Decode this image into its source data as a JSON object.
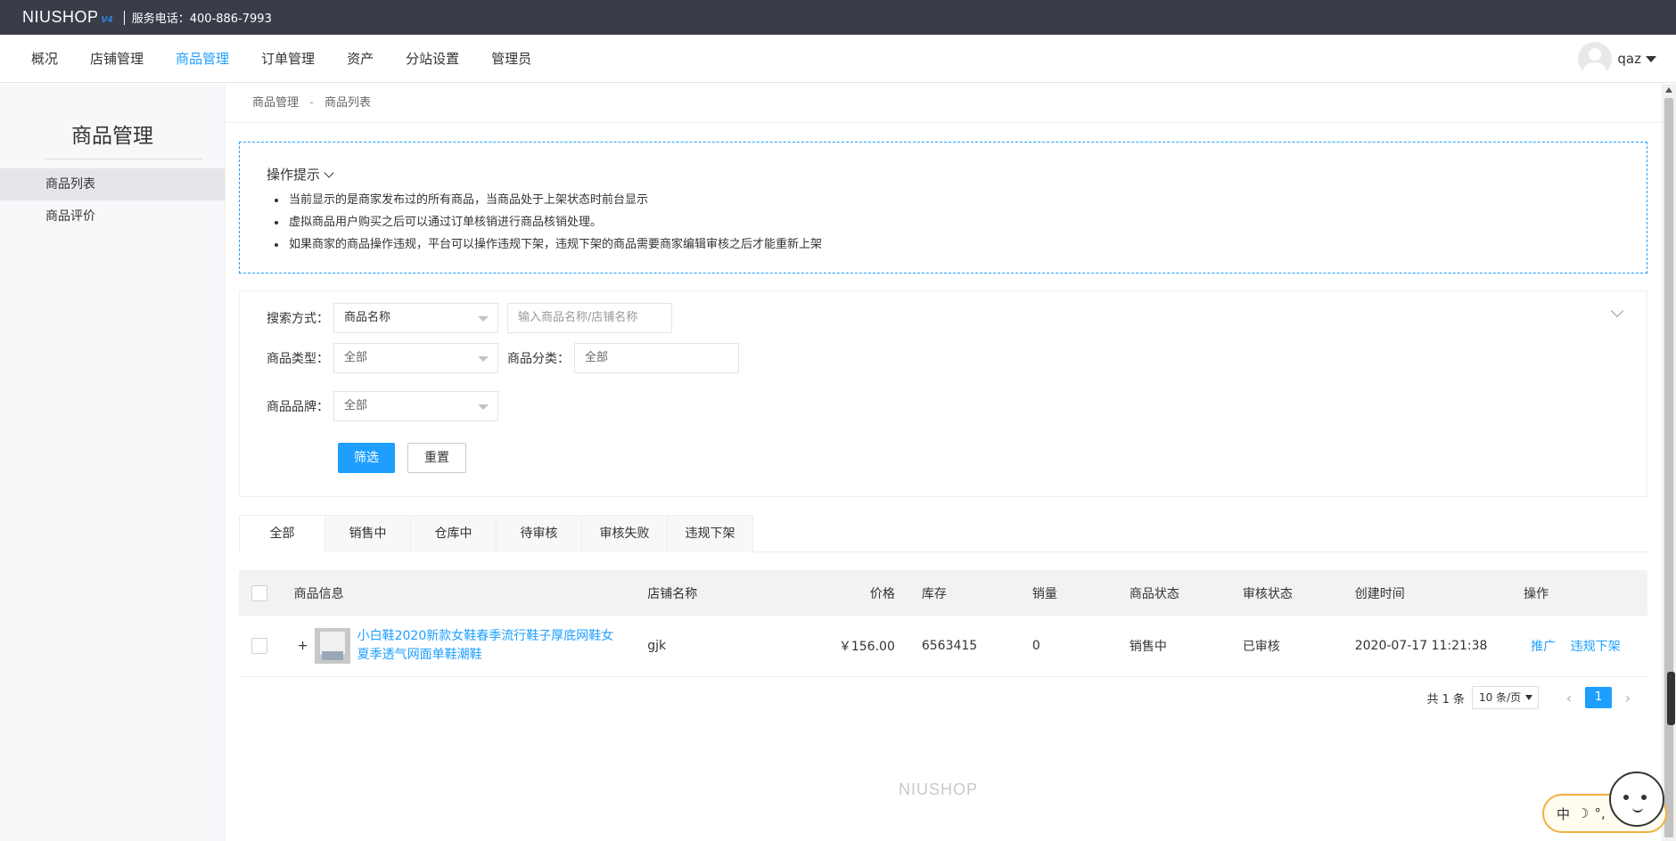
{
  "topbar": {
    "logo": "NIUSHOP",
    "logo_version": "V4",
    "phone": "服务电话：400-886-7993"
  },
  "nav": {
    "items": [
      "概况",
      "店铺管理",
      "商品管理",
      "订单管理",
      "资产",
      "分站设置",
      "管理员"
    ],
    "active_index": 2,
    "user_name": "qaz"
  },
  "sidebar": {
    "title": "商品管理",
    "items": [
      "商品列表",
      "商品评价"
    ],
    "active_index": 0
  },
  "breadcrumb": {
    "parent": "商品管理",
    "separator": "-",
    "current": "商品列表"
  },
  "tips": {
    "title": "操作提示",
    "items": [
      "当前显示的是商家发布过的所有商品，当商品处于上架状态时前台显示",
      "虚拟商品用户购买之后可以通过订单核销进行商品核销处理。",
      "如果商家的商品操作违规，平台可以操作违规下架，违规下架的商品需要商家编辑审核之后才能重新上架"
    ]
  },
  "filter": {
    "search_label": "搜索方式：",
    "search_select": "商品名称",
    "search_placeholder": "输入商品名称/店铺名称",
    "type_label": "商品类型：",
    "type_value": "全部",
    "category_label": "商品分类：",
    "category_value": "全部",
    "brand_label": "商品品牌：",
    "brand_value": "全部",
    "submit_label": "筛选",
    "reset_label": "重置"
  },
  "tabs": [
    "全部",
    "销售中",
    "仓库中",
    "待审核",
    "审核失败",
    "违规下架"
  ],
  "table": {
    "headers": [
      "商品信息",
      "店铺名称",
      "价格",
      "库存",
      "销量",
      "商品状态",
      "审核状态",
      "创建时间",
      "操作"
    ],
    "rows": [
      {
        "expand": "+",
        "name": "小白鞋2020新款女鞋春季流行鞋子厚底网鞋女夏季透气网面单鞋潮鞋",
        "shop": "gjk",
        "price": "￥156.00",
        "stock": "6563415",
        "sales": "0",
        "status": "销售中",
        "audit": "已审核",
        "created": "2020-07-17 11:21:38",
        "actions": [
          "推广",
          "违规下架"
        ]
      }
    ]
  },
  "pager": {
    "total": "共 1 条",
    "page_size": "10 条/页",
    "prev": "‹",
    "next": "›",
    "current": "1"
  },
  "footer": {
    "logo": "NIUSHOP"
  },
  "ime": {
    "lang": "中",
    "moon": "☽",
    "punct": "°,"
  },
  "colors": {
    "accent": "#1E9FFF",
    "topbar": "#393D49"
  }
}
